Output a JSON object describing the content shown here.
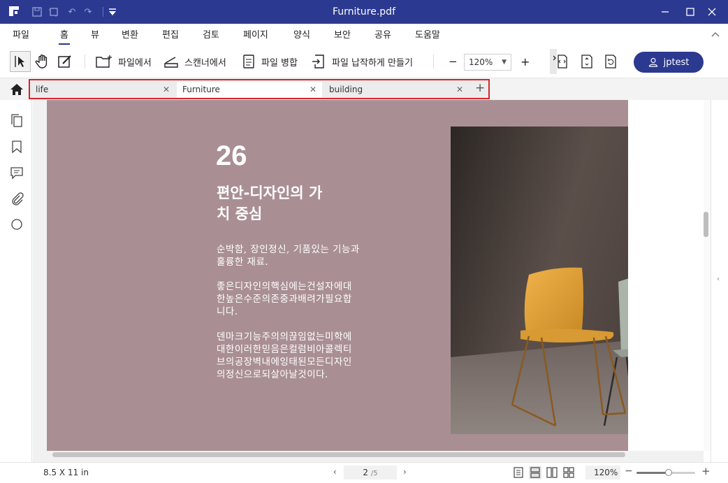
{
  "window": {
    "title": "Furniture.pdf"
  },
  "menu": {
    "items": [
      "파일",
      "홈",
      "뷰",
      "변환",
      "편집",
      "검토",
      "페이지",
      "양식",
      "보안",
      "공유",
      "도움말"
    ],
    "active": "홈"
  },
  "toolbar": {
    "from_file": "파일에서",
    "from_scanner": "스캔너에서",
    "merge_files": "파일 병합",
    "flatten_file": "파일 납작하게 만들기",
    "zoom": "120%",
    "zoom_minus": "−",
    "zoom_plus": "+",
    "user": "jptest"
  },
  "tabs": [
    {
      "label": "life",
      "active": false
    },
    {
      "label": "Furniture",
      "active": true
    },
    {
      "label": "building",
      "active": false
    }
  ],
  "tab_add": "+",
  "document": {
    "page_number": "26",
    "heading": [
      "편안-디자인의 가",
      "치 중심"
    ],
    "paragraph_1": [
      "순박함, 장인정신, 기품있는 기능과",
      "훌륭한 재료."
    ],
    "paragraph_2": [
      "좋은디자인의핵심에는건설자에대",
      "한높은수준의존중과배려가필요합",
      "니다."
    ],
    "paragraph_3": [
      "덴마크기능주의의끊임없는미학에",
      "대한이러한믿음은컬럼비아콜렉티",
      "브의공장벽내에잉태된모든디자인",
      "의정신으로되살아날것이다."
    ]
  },
  "status": {
    "page_size": "8.5 X 11 in",
    "current_page": "2",
    "total_pages": "/5",
    "zoom": "120%",
    "zoom_level": 0.55
  },
  "colors": {
    "title_bar": "#2b3990",
    "page_background": "#a98f94",
    "tab_highlight": "#d8232a",
    "chair_front": "#e3a53a",
    "chair_back": "#a9b2a6"
  }
}
